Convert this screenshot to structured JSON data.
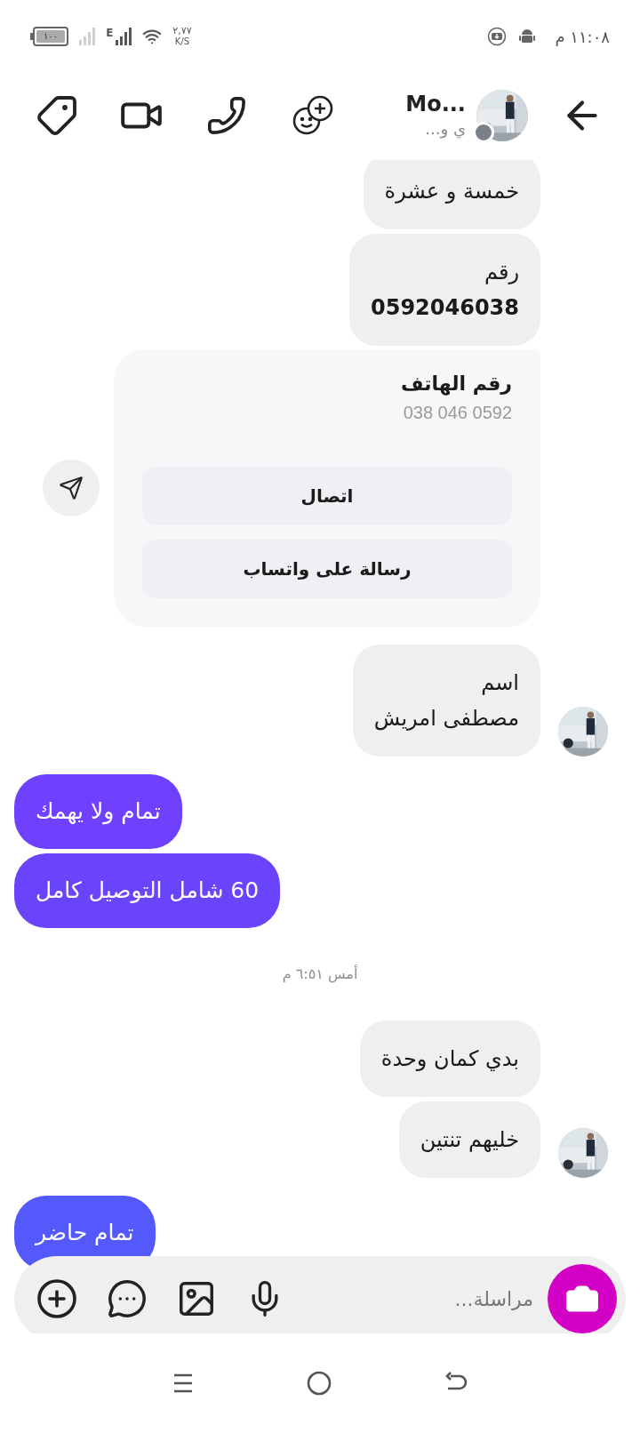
{
  "status_bar": {
    "battery": "١٠٠",
    "network_type": "E",
    "speed": "٢,٧٧",
    "speed_unit": "K/S",
    "time": "١١:٠٨ م"
  },
  "header": {
    "name": "Mo...",
    "subtitle": "ي و..."
  },
  "messages": [
    {
      "kind": "received",
      "lines": [
        "خمسة و عشرة"
      ],
      "avatar": false
    },
    {
      "kind": "received",
      "lines": [
        "رقم",
        "**0592046038**"
      ],
      "avatar": false
    },
    {
      "kind": "card",
      "title": "رقم الهاتف",
      "number": "038 046 0592",
      "buttons": [
        "اتصال",
        "رسالة على واتساب"
      ]
    },
    {
      "kind": "received",
      "lines": [
        "اسم",
        "مصطفى امريش"
      ],
      "avatar": true
    },
    {
      "kind": "sent",
      "lines": [
        "تمام ولا يهمك"
      ],
      "color": "#7040ff"
    },
    {
      "kind": "sent",
      "lines": [
        "60 شامل التوصيل كامل"
      ],
      "color": "#6a44fb"
    },
    {
      "kind": "timestamp",
      "text": "أمس ٦:٥١ م"
    },
    {
      "kind": "received",
      "lines": [
        "بدي كمان وحدة"
      ],
      "avatar": false
    },
    {
      "kind": "received",
      "lines": [
        "خليهم تنتين"
      ],
      "avatar": true
    },
    {
      "kind": "sent",
      "lines": [
        "تمام حاضر"
      ],
      "color": "#5359fa"
    }
  ],
  "composer": {
    "placeholder": "مراسلة..."
  }
}
